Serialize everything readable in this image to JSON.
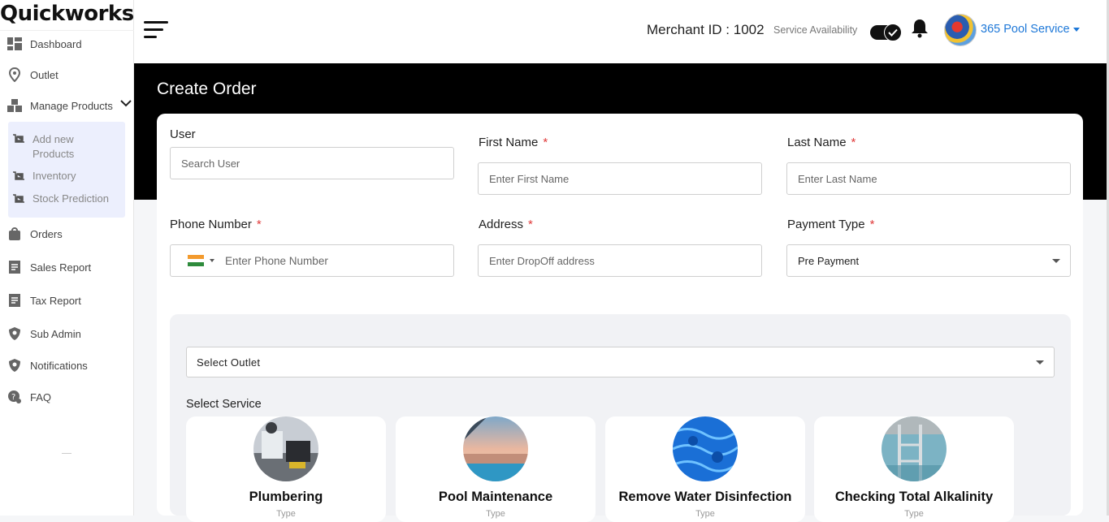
{
  "app": {
    "logo": "Quickworks"
  },
  "sidebar": {
    "items": [
      {
        "label": "Dashboard",
        "icon": "dashboard-icon"
      },
      {
        "label": "Outlet",
        "icon": "location-pin-icon"
      },
      {
        "label": "Manage Products",
        "icon": "boxes-icon"
      },
      {
        "label": "Orders",
        "icon": "shopping-bag-icon"
      },
      {
        "label": "Sales Report",
        "icon": "report-icon"
      },
      {
        "label": "Tax Report",
        "icon": "report-icon"
      },
      {
        "label": "Sub Admin",
        "icon": "shield-user-icon"
      },
      {
        "label": "Notifications",
        "icon": "shield-bell-icon"
      },
      {
        "label": "FAQ",
        "icon": "faq-icon"
      }
    ],
    "submenu": [
      {
        "label": "Add new Products",
        "icon": "cart-icon"
      },
      {
        "label": "Inventory",
        "icon": "cart-icon"
      },
      {
        "label": "Stock Prediction",
        "icon": "cart-icon"
      }
    ]
  },
  "header": {
    "merchant": "Merchant ID : 1002",
    "service_availability": "Service Availability",
    "service_available": true,
    "user_name": "365 Pool Service"
  },
  "page": {
    "title": "Create Order"
  },
  "form": {
    "user": {
      "label": "User",
      "placeholder": "Search User"
    },
    "first_name": {
      "label": "First Name",
      "required": "*",
      "placeholder": "Enter First Name"
    },
    "last_name": {
      "label": "Last Name",
      "required": "*",
      "placeholder": "Enter Last Name"
    },
    "phone": {
      "label": "Phone Number",
      "required": "*",
      "placeholder": "Enter Phone Number",
      "country_flag": "India"
    },
    "address": {
      "label": "Address",
      "required": "*",
      "placeholder": "Enter DropOff address"
    },
    "payment": {
      "label": "Payment Type",
      "required": "*",
      "value": "Pre Payment"
    }
  },
  "outlet": {
    "placeholder": "Select Outlet"
  },
  "services": {
    "heading": "Select Service",
    "items": [
      {
        "name": "Plumbering",
        "sub": "Type"
      },
      {
        "name": "Pool Maintenance",
        "sub": "Type"
      },
      {
        "name": "Remove Water Disinfection",
        "sub": "Type"
      },
      {
        "name": "Checking Total Alkalinity",
        "sub": "Type"
      }
    ]
  },
  "colors": {
    "accent": "#1e78d8",
    "required": "#e03a3a",
    "banner": "#000000",
    "submenu_bg": "#eceffd"
  }
}
